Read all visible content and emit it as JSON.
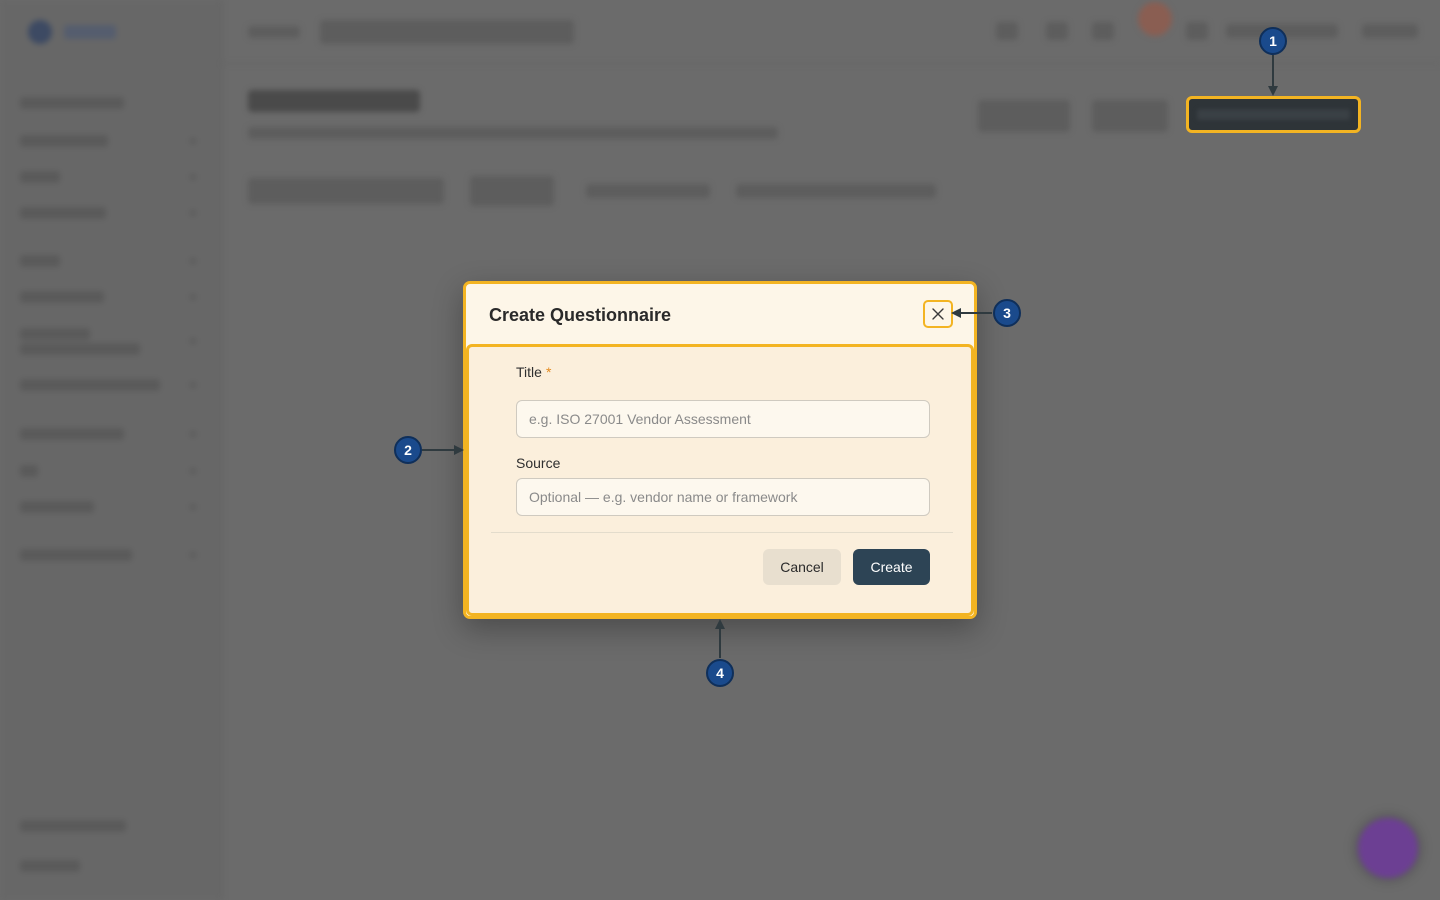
{
  "modal": {
    "title": "Create Questionnaire",
    "close_icon": "close-icon",
    "fields": {
      "title_label": "Title",
      "title_required_mark": "*",
      "title_placeholder": "e.g. ISO 27001 Vendor Assessment",
      "source_label": "Source",
      "source_placeholder": "Optional — e.g. vendor name or framework"
    },
    "buttons": {
      "cancel": "Cancel",
      "create": "Create"
    }
  },
  "annotations": [
    "1",
    "2",
    "3",
    "4"
  ],
  "colors": {
    "highlight": "#f3b422",
    "marker": "#1a4a8c",
    "primary_button": "#2d4455",
    "modal_background": "#fdf6e8",
    "overlay": "#6b6b6b",
    "chat_bubble": "#6c3f93"
  }
}
